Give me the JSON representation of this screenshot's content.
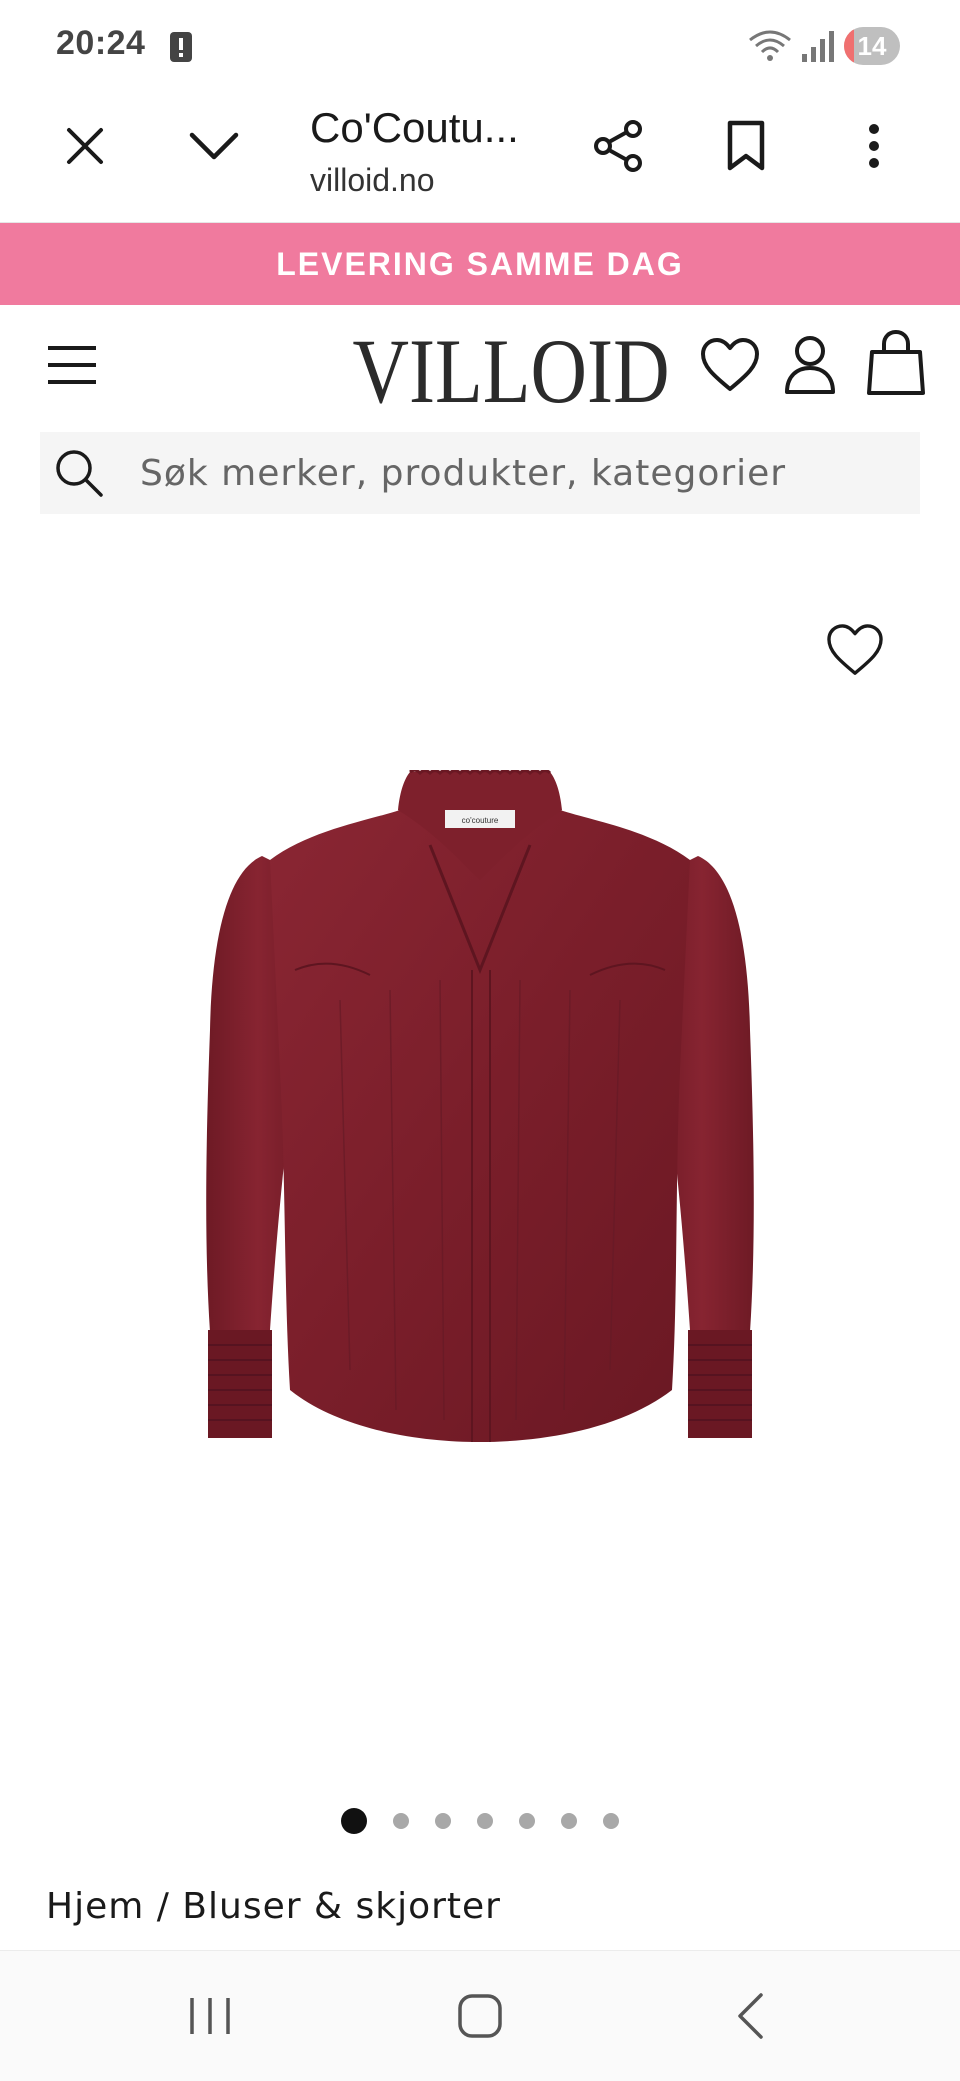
{
  "status_bar": {
    "time": "20:24",
    "battery": "14"
  },
  "browser": {
    "page_title": "Co'Coutu...",
    "url": "villoid.no"
  },
  "promo": {
    "text": "LEVERING SAMME DAG"
  },
  "header": {
    "logo_text": "VILLOID"
  },
  "search": {
    "placeholder": "Søk merker, produkter, kategorier"
  },
  "product": {
    "image_count": 7,
    "active_image": 1,
    "brand_label": "co'couture",
    "color": "#7a1e2a"
  },
  "breadcrumb": {
    "text": "Hjem / Bluser & skjorter"
  },
  "colors": {
    "promo_bg": "#f07a9e",
    "accent": "#111111"
  }
}
